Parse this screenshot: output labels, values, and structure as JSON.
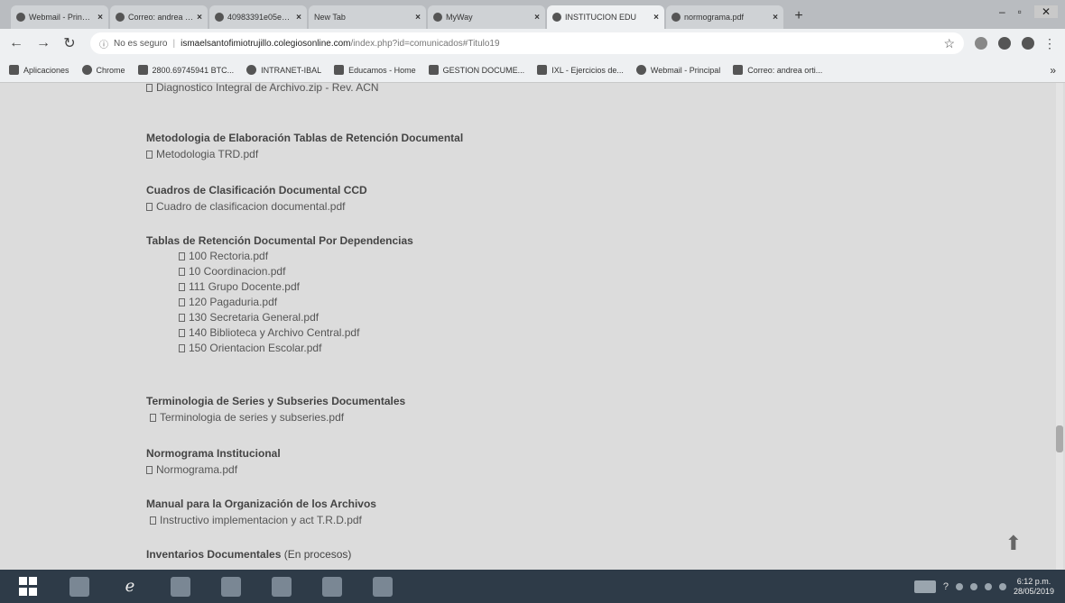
{
  "tabs": [
    {
      "title": "Webmail - Principal",
      "active": false
    },
    {
      "title": "Correo: andrea ort",
      "active": false
    },
    {
      "title": "40983391e05edef",
      "active": false
    },
    {
      "title": "New Tab",
      "active": false
    },
    {
      "title": "MyWay",
      "active": false
    },
    {
      "title": "INSTITUCION EDU",
      "active": true
    },
    {
      "title": "normograma.pdf",
      "active": false
    }
  ],
  "address": {
    "security_label": "No es seguro",
    "host": "ismaelsantofimiotrujillo.colegiosonline.com",
    "path": "/index.php?id=comunicados#Titulo19"
  },
  "bookmarks": [
    "Aplicaciones",
    "Chrome",
    "2800.69745941 BTC...",
    "INTRANET-IBAL",
    "Educamos - Home",
    "GESTION DOCUME...",
    "IXL - Ejercicios de...",
    "Webmail - Principal",
    "Correo: andrea orti..."
  ],
  "content": {
    "cut_line": "Diagnostico Integral de Archivo.zip - Rev. ACN",
    "sections": [
      {
        "heading": "Metodologia de Elaboración Tablas de Retención Documental",
        "files": [
          "Metodologia TRD.pdf"
        ]
      },
      {
        "heading": "Cuadros de Clasificación Documental CCD",
        "files": [
          "Cuadro de clasificacion documental.pdf"
        ]
      },
      {
        "heading": "Tablas de Retención Documental Por Dependencias",
        "files": [
          "100 Rectoria.pdf",
          "10 Coordinacion.pdf",
          "111 Grupo Docente.pdf",
          "120 Pagaduria.pdf",
          "130 Secretaria General.pdf",
          "140 Biblioteca y Archivo Central.pdf",
          "150 Orientacion Escolar.pdf"
        ]
      },
      {
        "heading": "Terminologia de Series y Subseries Documentales",
        "files": [
          "Terminologia de series y subseries.pdf"
        ]
      },
      {
        "heading": "Normograma Institucional",
        "files": [
          "Normograma.pdf"
        ]
      },
      {
        "heading": "Manual para la Organización de los Archivos",
        "files": [
          "Instructivo implementacion y act T.R.D.pdf"
        ]
      },
      {
        "heading": "Inventarios Documentales",
        "heading_note": "(En procesos)",
        "files": []
      }
    ]
  },
  "taskbar": {
    "clock_time": "6:12 p.m.",
    "clock_date": "28/05/2019"
  }
}
